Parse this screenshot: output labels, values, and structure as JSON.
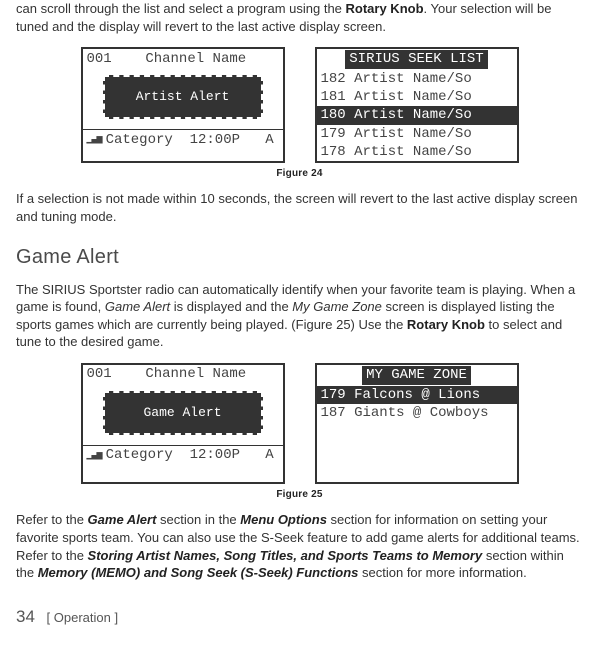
{
  "intro1_a": "can scroll through the list and select a program using the ",
  "intro1_bold": "Rotary Knob",
  "intro1_b": ". Your selection will be tuned and the display will revert to the last active display screen.",
  "fig24": {
    "left": {
      "ch_num": "001",
      "ch_name": "Channel Name",
      "modal": "Artist Alert",
      "category": "Category",
      "time": "12:00P",
      "badge": "A"
    },
    "right": {
      "title": "SIRIUS SEEK LIST",
      "rows": [
        {
          "n": "182",
          "t": "Artist Name/So"
        },
        {
          "n": "181",
          "t": "Artist Name/So"
        },
        {
          "n": "180",
          "t": "Artist Name/So"
        },
        {
          "n": "179",
          "t": "Artist Name/So"
        },
        {
          "n": "178",
          "t": "Artist Name/So"
        }
      ],
      "hl_index": 2
    },
    "caption": "Figure 24"
  },
  "after24": "If a selection is not made within 10 seconds, the screen will revert to the last active display screen and tuning mode.",
  "game_alert_h": "Game Alert",
  "ga_p_a": "The SIRIUS Sportster radio can automatically identify when your favorite team is playing. When a game is found, ",
  "ga_p_i1": "Game Alert",
  "ga_p_b": " is displayed and the ",
  "ga_p_i2": "My Game Zone",
  "ga_p_c": " screen is displayed listing the sports games which are currently being played. (Figure 25) Use the ",
  "ga_p_bold": "Rotary Knob",
  "ga_p_d": " to select and tune to the desired game.",
  "fig25": {
    "left": {
      "ch_num": "001",
      "ch_name": "Channel Name",
      "modal": "Game Alert",
      "category": "Category",
      "time": "12:00P",
      "badge": "A"
    },
    "right": {
      "title": "MY GAME ZONE",
      "rows": [
        {
          "n": "179",
          "t": "Falcons @ Lions"
        },
        {
          "n": "187",
          "t": "Giants @ Cowboys"
        }
      ],
      "hl_index": 0
    },
    "caption": "Figure 25"
  },
  "closing_a": "Refer to the ",
  "closing_bi1": "Game Alert",
  "closing_b": " section in the ",
  "closing_bi2": "Menu Options",
  "closing_c": " section for information on setting your favorite sports team. You can also use the S-Seek feature to add game alerts for additional teams.  Refer to the ",
  "closing_bi3": "Storing Artist Names, Song Titles, and Sports Teams to Memory",
  "closing_d": " section within the ",
  "closing_bi4": "Memory (MEMO) and Song Seek (S-Seek) Functions",
  "closing_e": " section for more information.",
  "page_num": "34",
  "page_label": "Operation"
}
